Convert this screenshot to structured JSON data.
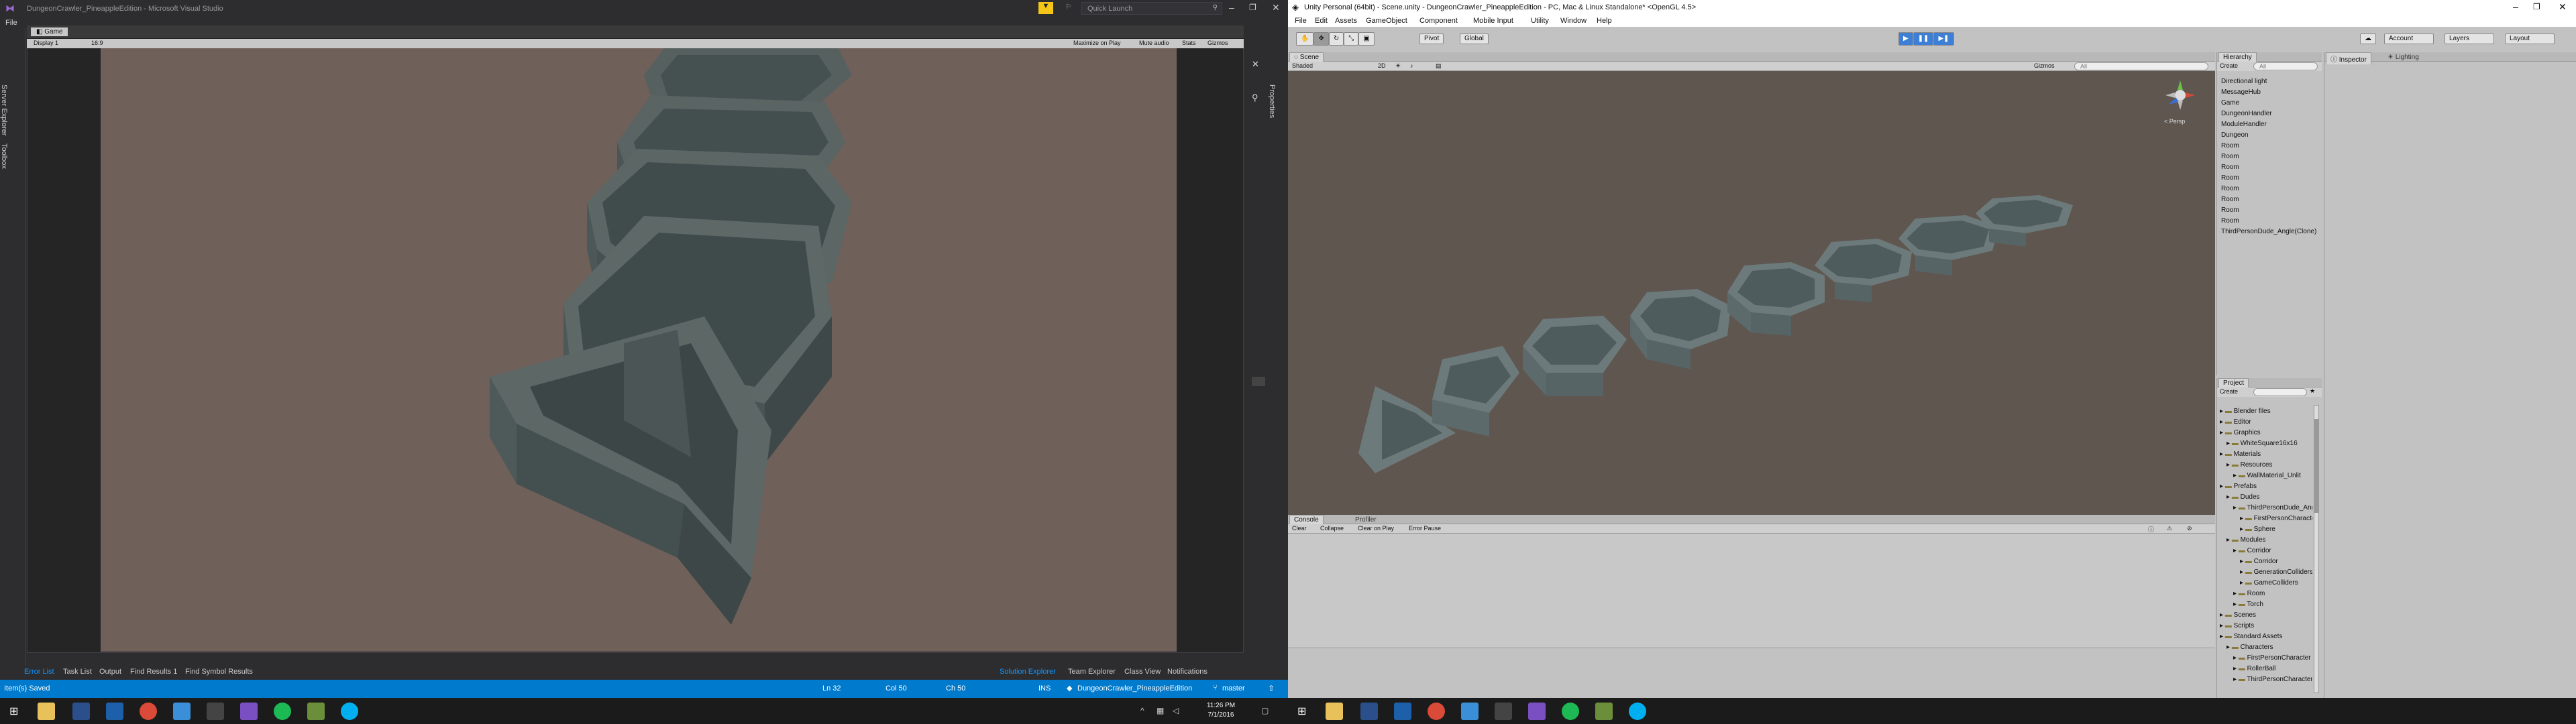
{
  "vs": {
    "title": "DungeonCrawler_PineappleEdition - Microsoft Visual Studio",
    "quick_launch_placeholder": "Quick Launch",
    "menu_first": "File",
    "side_tabs": [
      "Server Explorer",
      "Toolbox"
    ],
    "right_tab": "Properties",
    "game_tab": "Game",
    "display_label": "Display 1",
    "aspect_label": "16:9",
    "game_toggles": [
      "Maximize on Play",
      "Mute audio",
      "Stats",
      "Gizmos"
    ],
    "bottom_tabs": [
      "Error List",
      "Task List",
      "Output",
      "Find Results 1",
      "Find Symbol Results"
    ],
    "bottom_right_tabs": [
      "Solution Explorer",
      "Team Explorer",
      "Class View",
      "Notifications"
    ],
    "status": {
      "left": "Item(s) Saved",
      "ln": "Ln 32",
      "col": "Col 50",
      "ch": "Ch 50",
      "ins": "INS",
      "repo": "DungeonCrawler_PineappleEdition",
      "branch": "master"
    }
  },
  "unity": {
    "title": "Unity Personal (64bit) - Scene.unity - DungeonCrawler_PineappleEdition - PC, Mac & Linux Standalone* <OpenGL 4.5>",
    "menu": [
      "File",
      "Edit",
      "Assets",
      "GameObject",
      "Component",
      "Mobile Input",
      "Utility",
      "Window",
      "Help"
    ],
    "toolbar": {
      "pivot": "Pivot",
      "global": "Global",
      "account": "Account",
      "layers": "Layers",
      "layout": "Layout"
    },
    "scene": {
      "tab": "Scene",
      "shading": "Shaded",
      "mode": "2D",
      "gizmos": "Gizmos",
      "search_placeholder": "All",
      "persp": "< Persp"
    },
    "console": {
      "tabs": [
        "Console",
        "Profiler"
      ],
      "buttons": [
        "Clear",
        "Collapse",
        "Clear on Play",
        "Error Pause"
      ]
    },
    "hierarchy": {
      "tab": "Hierarchy",
      "create": "Create",
      "search_placeholder": "All",
      "items": [
        "Directional light",
        "MessageHub",
        "Game",
        "DungeonHandler",
        "ModuleHandler",
        "Dungeon",
        "Room",
        "Room",
        "Room",
        "Room",
        "Room",
        "Room",
        "Room",
        "Room",
        "ThirdPersonDude_Angle(Clone)"
      ]
    },
    "project": {
      "tab": "Project",
      "create": "Create",
      "items": [
        {
          "label": "Blender files",
          "depth": 0
        },
        {
          "label": "Editor",
          "depth": 0
        },
        {
          "label": "Graphics",
          "depth": 0
        },
        {
          "label": "WhiteSquare16x16",
          "depth": 1
        },
        {
          "label": "Materials",
          "depth": 0
        },
        {
          "label": "Resources",
          "depth": 1
        },
        {
          "label": "WallMaterial_Unlit",
          "depth": 2
        },
        {
          "label": "Prefabs",
          "depth": 0
        },
        {
          "label": "Dudes",
          "depth": 1
        },
        {
          "label": "ThirdPersonDude_Angle",
          "depth": 2
        },
        {
          "label": "FirstPersonCharacter",
          "depth": 3
        },
        {
          "label": "Sphere",
          "depth": 3
        },
        {
          "label": "Modules",
          "depth": 1
        },
        {
          "label": "Corridor",
          "depth": 2
        },
        {
          "label": "Corridor",
          "depth": 3
        },
        {
          "label": "GenerationColliders",
          "depth": 3
        },
        {
          "label": "GameColliders",
          "depth": 3
        },
        {
          "label": "Room",
          "depth": 2
        },
        {
          "label": "Torch",
          "depth": 2
        },
        {
          "label": "Scenes",
          "depth": 0
        },
        {
          "label": "Scripts",
          "depth": 0
        },
        {
          "label": "Standard Assets",
          "depth": 0
        },
        {
          "label": "Characters",
          "depth": 1
        },
        {
          "label": "FirstPersonCharacter",
          "depth": 2
        },
        {
          "label": "RollerBall",
          "depth": 2
        },
        {
          "label": "ThirdPersonCharacter",
          "depth": 2
        }
      ]
    },
    "inspector": {
      "tabs": [
        "Inspector",
        "Lighting"
      ]
    }
  },
  "taskbar": {
    "time": "11:26 PM",
    "date": "7/1/2016"
  },
  "colors": {
    "vs_bg": "#2d2d30",
    "vs_accent": "#007acc",
    "unity_bg": "#c2c2c2",
    "viewport_bg": "#6f605a",
    "scene_bg": "#605650",
    "wall": "#4d5659"
  }
}
